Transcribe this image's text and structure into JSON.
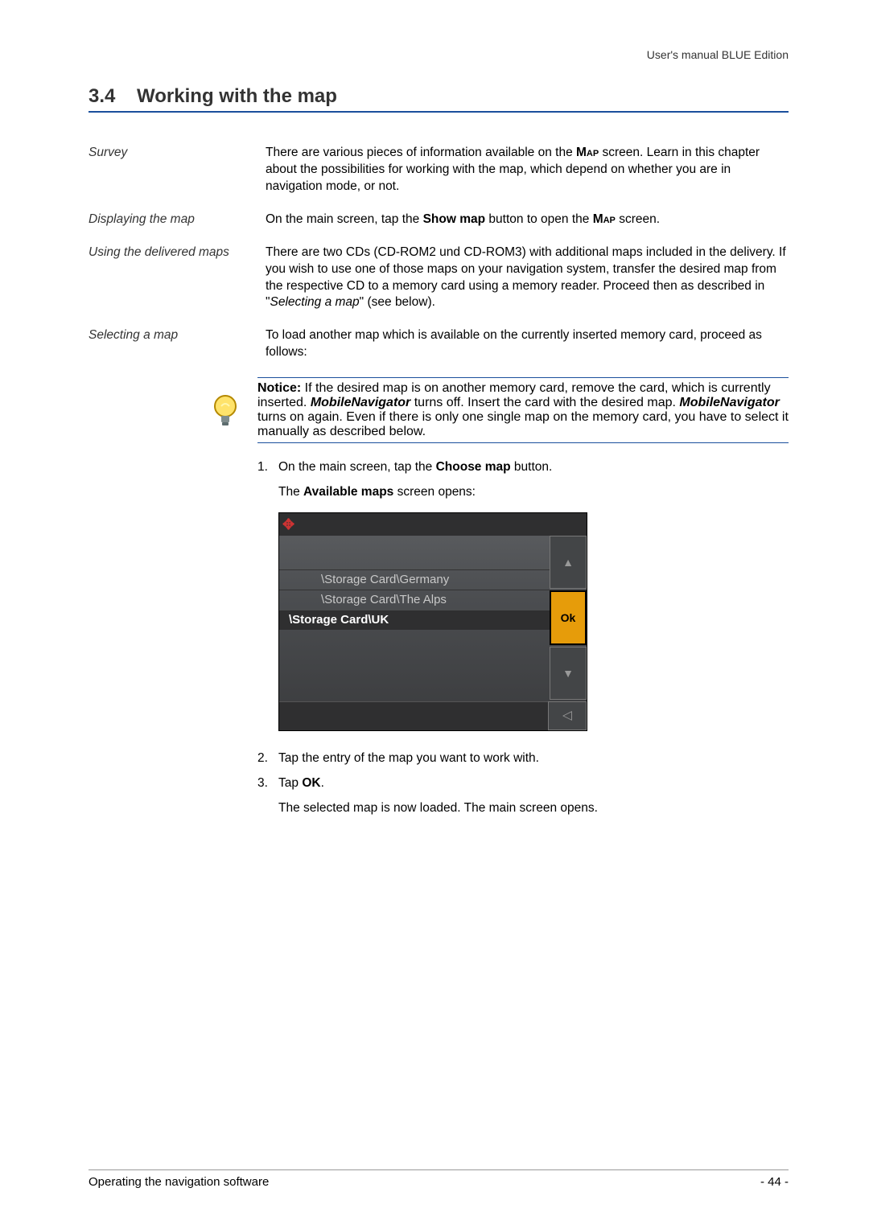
{
  "header": {
    "right": "User's manual BLUE Edition"
  },
  "section": {
    "number": "3.4",
    "title": "Working with the map"
  },
  "survey": {
    "label": "Survey",
    "text_before": "There are various pieces of information available on the ",
    "map_word": "Map",
    "text_after": " screen. Learn in this chapter about the possibilities for working with the map, which depend on whether you are in navigation mode, or not."
  },
  "displaying": {
    "label": "Displaying the map",
    "t1": "On the main screen, tap the ",
    "show_map": "Show map",
    "t2": " button to open the ",
    "map_word": "Map",
    "t3": " screen."
  },
  "delivered": {
    "label": "Using the delivered maps",
    "t1": "There are two CDs (CD-ROM2 und CD-ROM3) with additional maps included in the delivery. If you wish to use one of those maps on your navigation system, transfer the desired map from the respective CD to a memory card using a memory reader. Proceed then as described in \"",
    "link": "Selecting a map",
    "t2": "\" (see below)."
  },
  "selecting": {
    "label": "Selecting a map",
    "text": "To load another map which is available on the currently inserted memory card, proceed as follows:"
  },
  "notice": {
    "label": "Notice:",
    "t1": " If the desired map is on another memory card, remove the card, which is currently inserted. ",
    "mn1": "MobileNavigator",
    "t2": " turns off. Insert the card with the desired map. ",
    "mn2": "MobileNavigator",
    "t3": " turns on again. Even if there is only one single map on the memory card, you have to select it manually as described below."
  },
  "steps": {
    "s1_num": "1.",
    "s1_a": "On the main screen, tap the ",
    "s1_choose": "Choose map",
    "s1_b": " button.",
    "s1_sub_a": "The ",
    "s1_sub_bold": "Available maps",
    "s1_sub_b": " screen opens:",
    "s2_num": "2.",
    "s2": "Tap the entry of the map you want to work with.",
    "s3_num": "3.",
    "s3_a": "Tap ",
    "s3_ok": "OK",
    "s3_b": ".",
    "s3_sub": "The selected map is now loaded. The main screen opens."
  },
  "screenshot": {
    "items": {
      "i0": "\\Storage Card\\Germany",
      "i1": "\\Storage Card\\The Alps",
      "i2": "\\Storage Card\\UK"
    },
    "ok": "Ok",
    "up": "▲",
    "down": "▼",
    "back": "◁",
    "move": "✥"
  },
  "footer": {
    "left": "Operating the navigation software",
    "right": "- 44 -"
  }
}
